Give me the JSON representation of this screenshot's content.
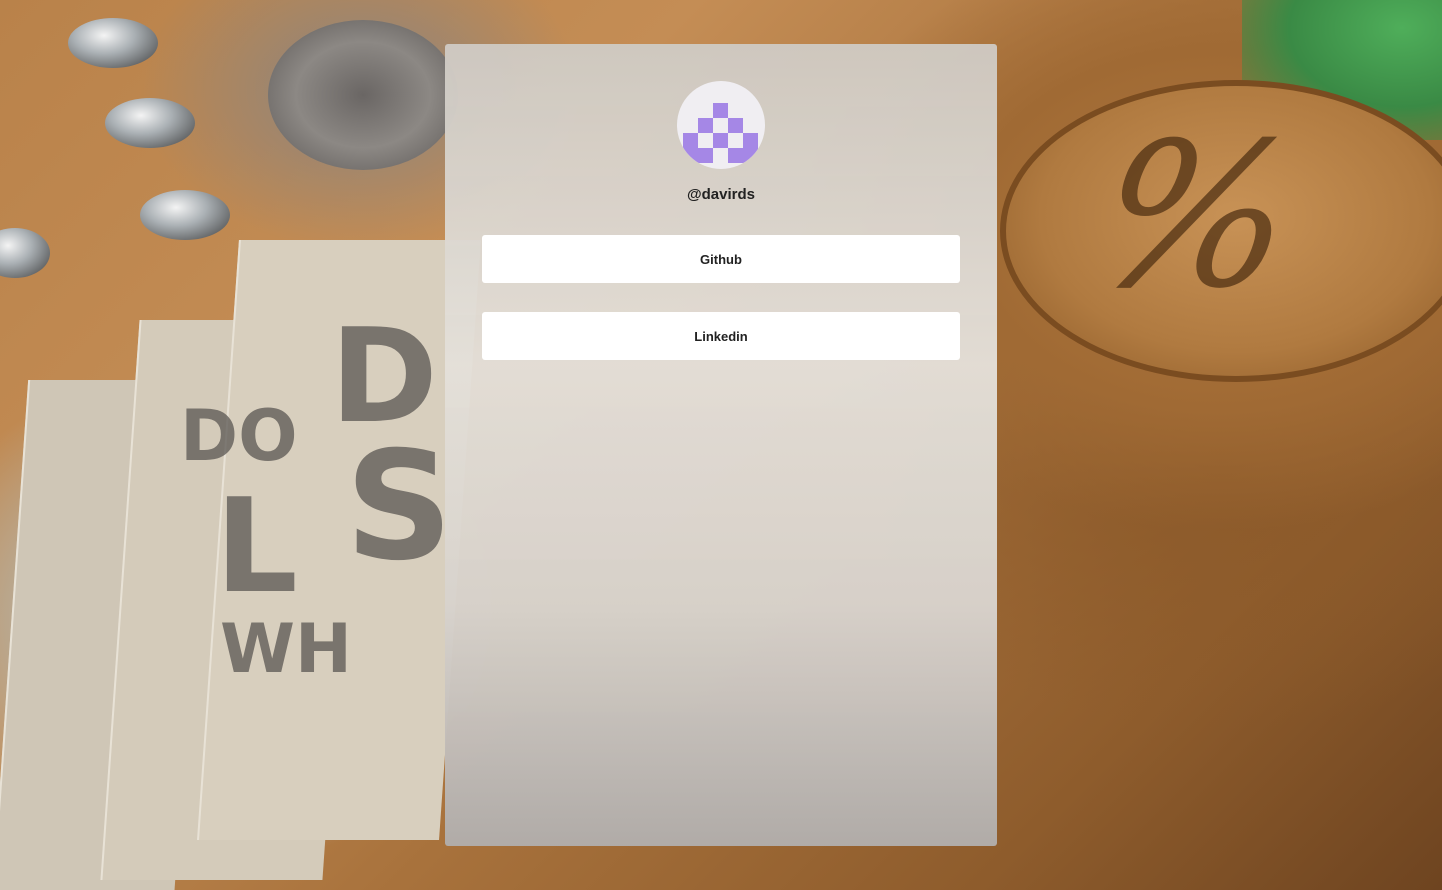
{
  "profile": {
    "handle": "@davirds",
    "avatar_icon": "pixel-identicon-icon",
    "avatar_color": "#a587e6"
  },
  "links": {
    "github_label": "Github",
    "linkedin_label": "Linkedin"
  },
  "background": {
    "image_icon": "workshop-desk-photo",
    "coaster_text": "%",
    "booklet_texts": [
      "DO",
      "L",
      "WH",
      "D",
      "S"
    ]
  }
}
